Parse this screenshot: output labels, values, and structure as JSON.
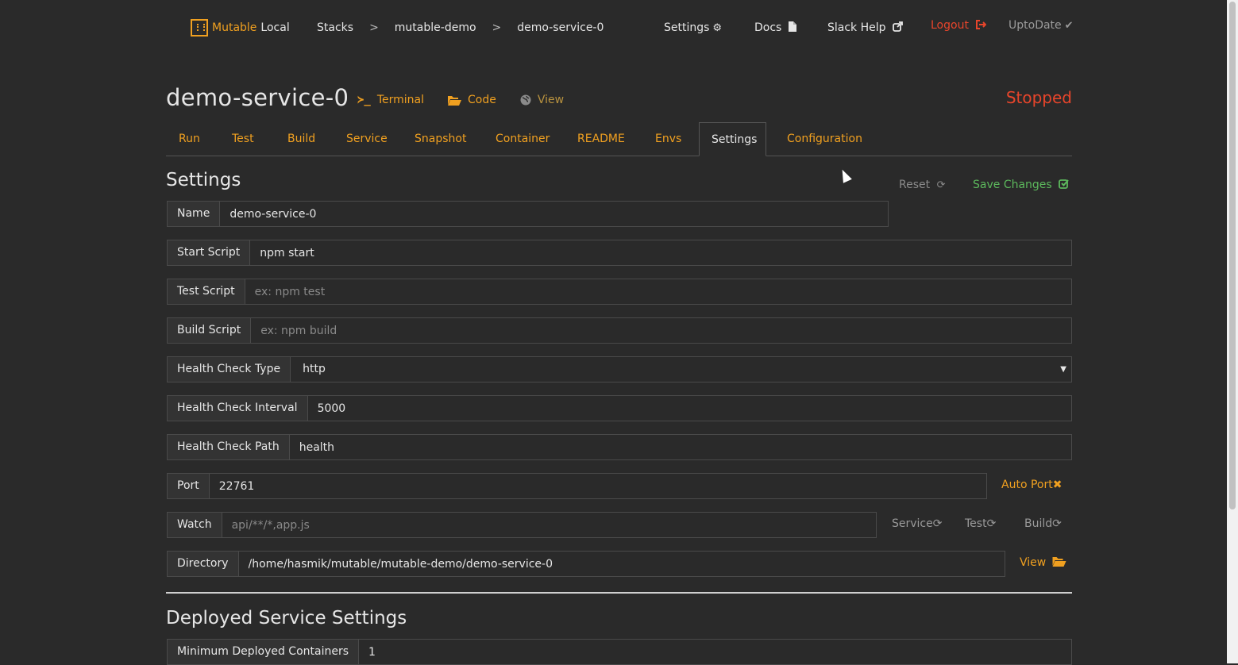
{
  "colors": {
    "accent": "#f0a020",
    "danger": "#e8452b",
    "success": "#5cb85c",
    "background": "#2a2a2a"
  },
  "brand": {
    "name_accent": "Mutable",
    "name_rest": "Local",
    "icon": "mutable-logo-icon"
  },
  "breadcrumb": {
    "items": [
      "Stacks",
      "mutable-demo",
      "demo-service-0"
    ],
    "separator": ">"
  },
  "nav": {
    "settings": {
      "label": "Settings",
      "icon": "gear-icon"
    },
    "docs": {
      "label": "Docs",
      "icon": "file-icon"
    },
    "slack": {
      "label": "Slack Help",
      "icon": "external-link-icon"
    },
    "logout": {
      "label": "Logout",
      "icon": "sign-out-icon"
    },
    "status": {
      "label": "UptoDate",
      "icon": "check-icon"
    }
  },
  "service": {
    "name": "demo-service-0",
    "status": "Stopped",
    "actions": [
      {
        "label": "Terminal",
        "icon": "terminal-icon"
      },
      {
        "label": "Code",
        "icon": "folder-open-icon"
      },
      {
        "label": "View",
        "icon": "globe-icon"
      }
    ]
  },
  "tabs": [
    "Run",
    "Test",
    "Build",
    "Service",
    "Snapshot",
    "Container",
    "README",
    "Envs",
    "Settings",
    "Configuration"
  ],
  "active_tab": "Settings",
  "settings": {
    "title": "Settings",
    "reset_label": "Reset",
    "save_label": "Save Changes",
    "fields": {
      "name": {
        "label": "Name",
        "value": "demo-service-0"
      },
      "start_script": {
        "label": "Start Script",
        "value": "npm start"
      },
      "test_script": {
        "label": "Test Script",
        "value": "",
        "placeholder": "ex: npm test"
      },
      "build_script": {
        "label": "Build Script",
        "value": "",
        "placeholder": "ex: npm build"
      },
      "health_check_type": {
        "label": "Health Check Type",
        "value": "http"
      },
      "health_check_interval": {
        "label": "Health Check Interval",
        "value": "5000"
      },
      "health_check_path": {
        "label": "Health Check Path",
        "value": "health"
      },
      "port": {
        "label": "Port",
        "value": "22761",
        "auto_label": "Auto Port"
      },
      "watch": {
        "label": "Watch",
        "value": "",
        "placeholder": "api/**/*,app.js",
        "toggles": [
          "Service",
          "Test",
          "Build"
        ]
      },
      "directory": {
        "label": "Directory",
        "value": "/home/hasmik/mutable/mutable-demo/demo-service-0",
        "view_label": "View"
      }
    }
  },
  "deployed": {
    "title": "Deployed Service Settings",
    "min_containers": {
      "label": "Minimum Deployed Containers",
      "value": "1"
    }
  }
}
